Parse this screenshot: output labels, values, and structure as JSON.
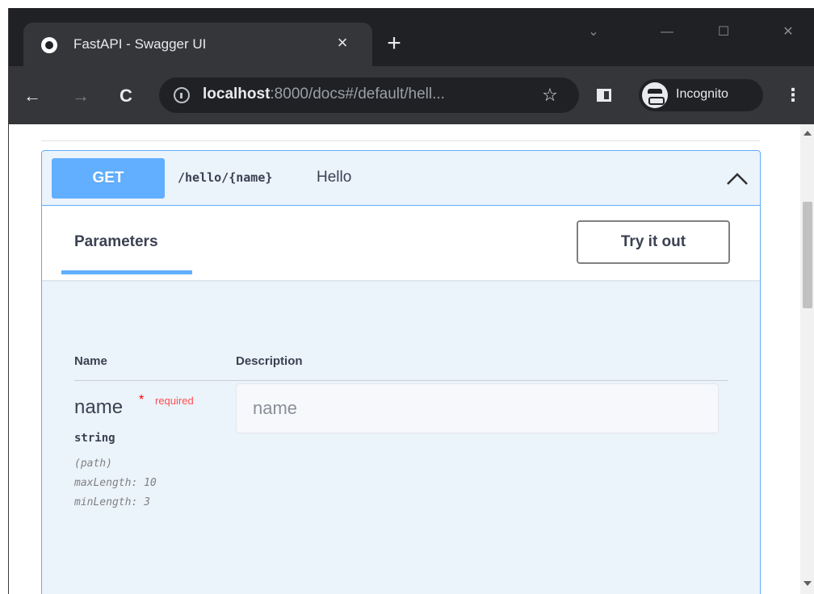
{
  "browser": {
    "tab_title": "FastAPI - Swagger UI",
    "tab_close": "×",
    "new_tab": "+",
    "url_host": "localhost",
    "url_rest": ":8000/docs#/default/hell...",
    "profile_label": "Incognito"
  },
  "operation": {
    "method": "GET",
    "path": "/hello/{name}",
    "summary": "Hello",
    "tab_label": "Parameters",
    "try_button": "Try it out",
    "columns": {
      "name": "Name",
      "description": "Description"
    },
    "parameter": {
      "name": "name",
      "required_star": "*",
      "required_label": "required",
      "type": "string",
      "location": "(path)",
      "max_length": "maxLength: 10",
      "min_length": "minLength: 3",
      "placeholder": "name"
    }
  },
  "colors": {
    "get_blue": "#61affe",
    "opblock_bg": "#ebf3fb",
    "text": "#3b4151",
    "required_red": "#ff4f4f"
  },
  "icons": {
    "back": "arrow-left-icon",
    "forward": "arrow-right-icon",
    "reload": "reload-icon",
    "info": "info-icon",
    "bookmark": "star-icon",
    "side_panel": "side-panel-icon",
    "incognito": "incognito-icon",
    "menu": "kebab-menu-icon",
    "collapse": "chevron-up-icon"
  }
}
